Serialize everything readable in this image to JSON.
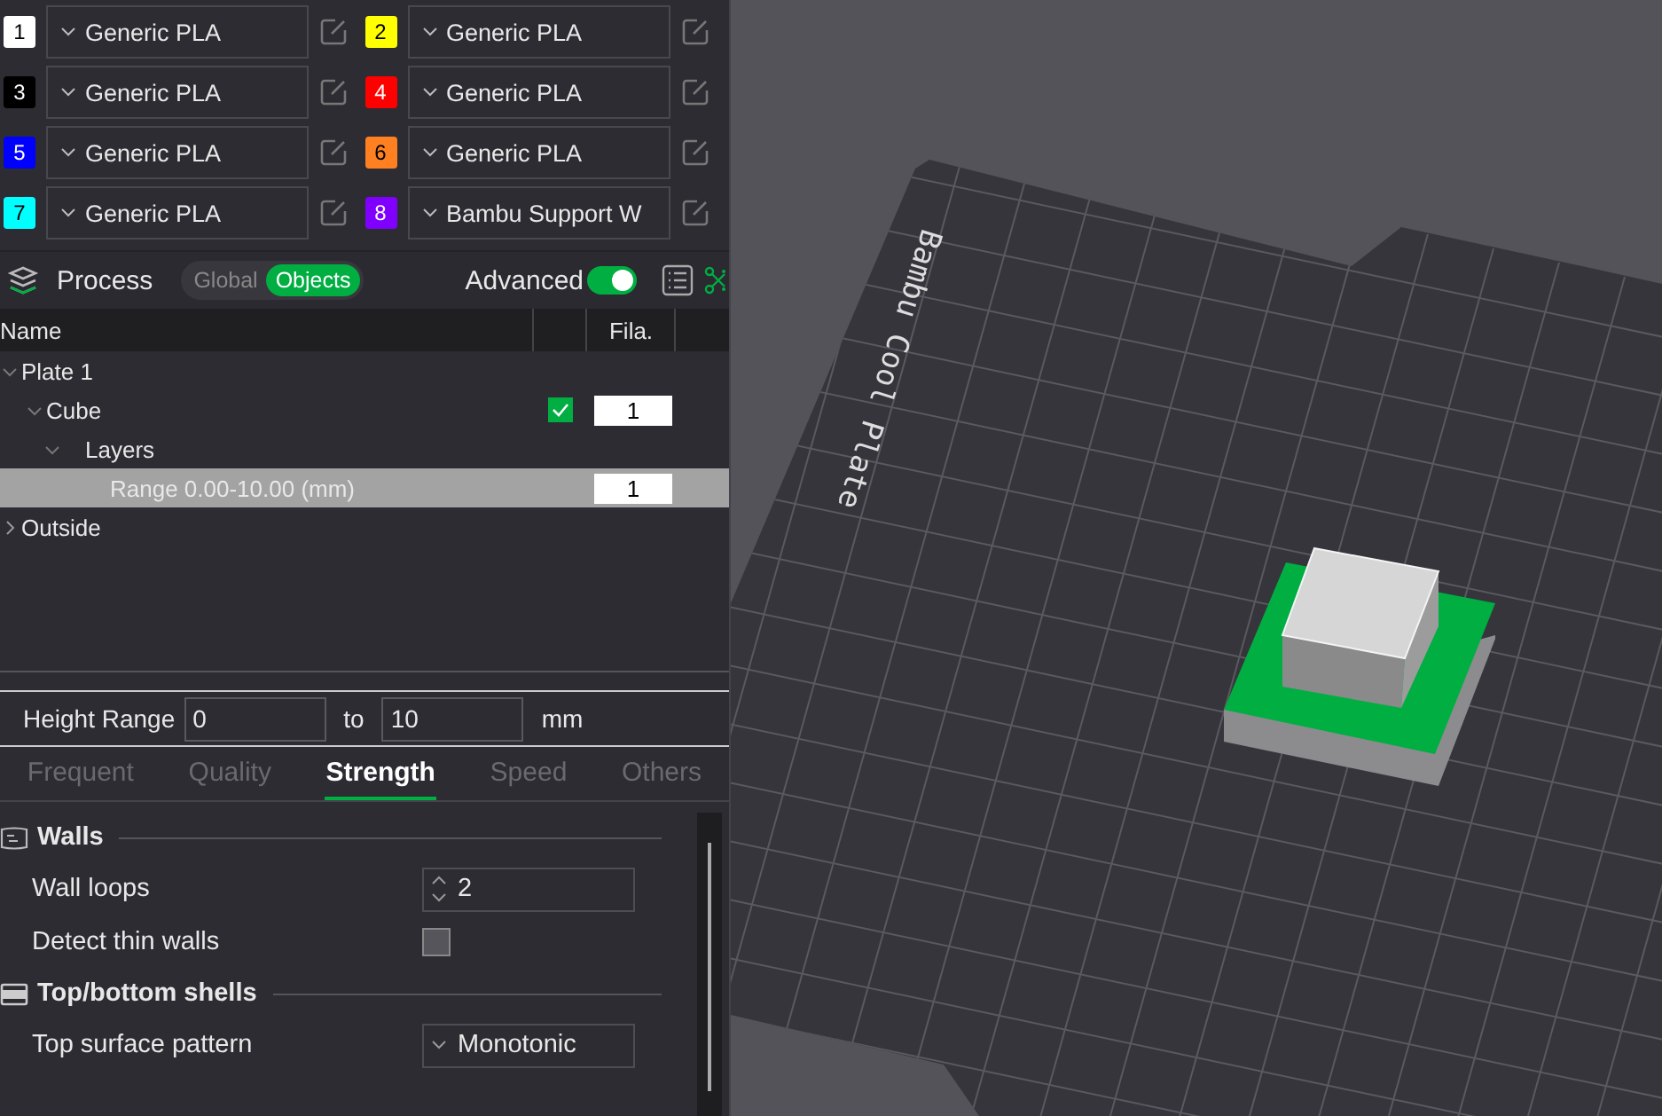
{
  "filaments": [
    {
      "index": "1",
      "color": "#ffffff",
      "name": "Generic PLA"
    },
    {
      "index": "2",
      "color": "#ffff00",
      "name": "Generic PLA"
    },
    {
      "index": "3",
      "color": "#000000",
      "name": "Generic PLA"
    },
    {
      "index": "4",
      "color": "#ff0000",
      "name": "Generic PLA"
    },
    {
      "index": "5",
      "color": "#0000ff",
      "name": "Generic PLA"
    },
    {
      "index": "6",
      "color": "#ff8020",
      "name": "Generic PLA"
    },
    {
      "index": "7",
      "color": "#00ffff",
      "name": "Generic PLA"
    },
    {
      "index": "8",
      "color": "#8000ff",
      "name": "Bambu Support W"
    }
  ],
  "process": {
    "title": "Process",
    "scope": [
      {
        "label": "Global",
        "selected": false
      },
      {
        "label": "Objects",
        "selected": true
      }
    ],
    "advanced": {
      "label": "Advanced",
      "on": true
    }
  },
  "object_list": {
    "columns": [
      {
        "label": "Name"
      },
      {
        "label": "Fila."
      }
    ],
    "rows": [
      {
        "name": "Plate 1",
        "expanded": true,
        "selected": false,
        "children": [
          {
            "name": "Cube",
            "expanded": true,
            "selected": false,
            "checked": true,
            "filament": "1",
            "children": [
              {
                "name": "Layers",
                "expanded": true,
                "selected": false,
                "children": [
                  {
                    "name": "Range 0.00-10.00 (mm)",
                    "selected": true,
                    "filament": "1"
                  }
                ]
              }
            ]
          }
        ]
      },
      {
        "name": "Outside",
        "expanded": false,
        "selected": false
      }
    ]
  },
  "height_range": {
    "label": "Height Range",
    "from": "0",
    "to_label": "to",
    "to": "10",
    "unit": "mm"
  },
  "tabs": [
    {
      "label": "Frequent",
      "selected": false
    },
    {
      "label": "Quality",
      "selected": false
    },
    {
      "label": "Strength",
      "selected": true
    },
    {
      "label": "Speed",
      "selected": false
    },
    {
      "label": "Others",
      "selected": false
    }
  ],
  "sections": [
    {
      "kind": "walls",
      "title": "Walls",
      "settings": [
        {
          "kind": "spin",
          "label": "Wall loops",
          "value": "2"
        },
        {
          "kind": "checkbox",
          "label": "Detect thin walls",
          "checked": false
        }
      ]
    },
    {
      "kind": "shells",
      "title": "Top/bottom shells",
      "settings": [
        {
          "kind": "dropdown",
          "label": "Top surface pattern",
          "value": "Monotonic"
        }
      ]
    }
  ],
  "viewport": {
    "plate_label": "Bambu Cool Plate"
  }
}
